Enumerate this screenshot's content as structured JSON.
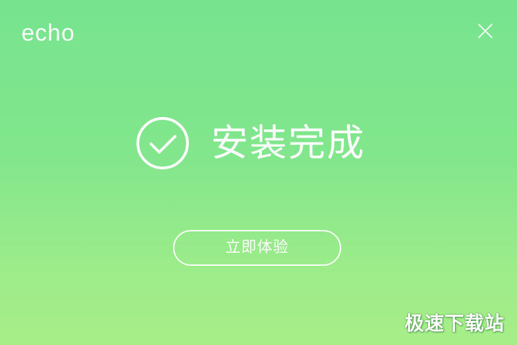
{
  "app": {
    "logo_text": "echo"
  },
  "window": {
    "close_icon": "close-icon",
    "background_top": "#77e38f",
    "background_bottom": "#a7ee88",
    "foreground": "#ffffff"
  },
  "status": {
    "icon": "check-circle-icon",
    "title": "安装完成"
  },
  "actions": {
    "start_button_label": "立即体验"
  },
  "watermark": {
    "text": "极速下载站"
  }
}
